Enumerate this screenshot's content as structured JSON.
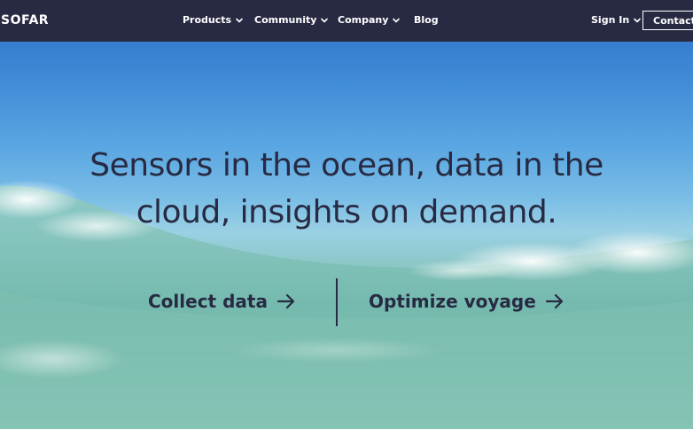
{
  "nav": {
    "logo": "SOFAR",
    "items": [
      {
        "label": "Products",
        "has_dropdown": true
      },
      {
        "label": "Community",
        "has_dropdown": true
      },
      {
        "label": "Company",
        "has_dropdown": true
      },
      {
        "label": "Blog",
        "has_dropdown": false
      }
    ],
    "sign_in": "Sign In",
    "contact": "Contact"
  },
  "hero": {
    "headline_line1": "Sensors in the ocean, data in the",
    "headline_line2": "cloud, insights on demand.",
    "cta_left": "Collect data",
    "cta_right": "Optimize voyage"
  },
  "colors": {
    "nav_bg": "#272a42",
    "text_dark": "#272a42",
    "sky": "#2c6fc8",
    "water": "#84c3b5"
  }
}
